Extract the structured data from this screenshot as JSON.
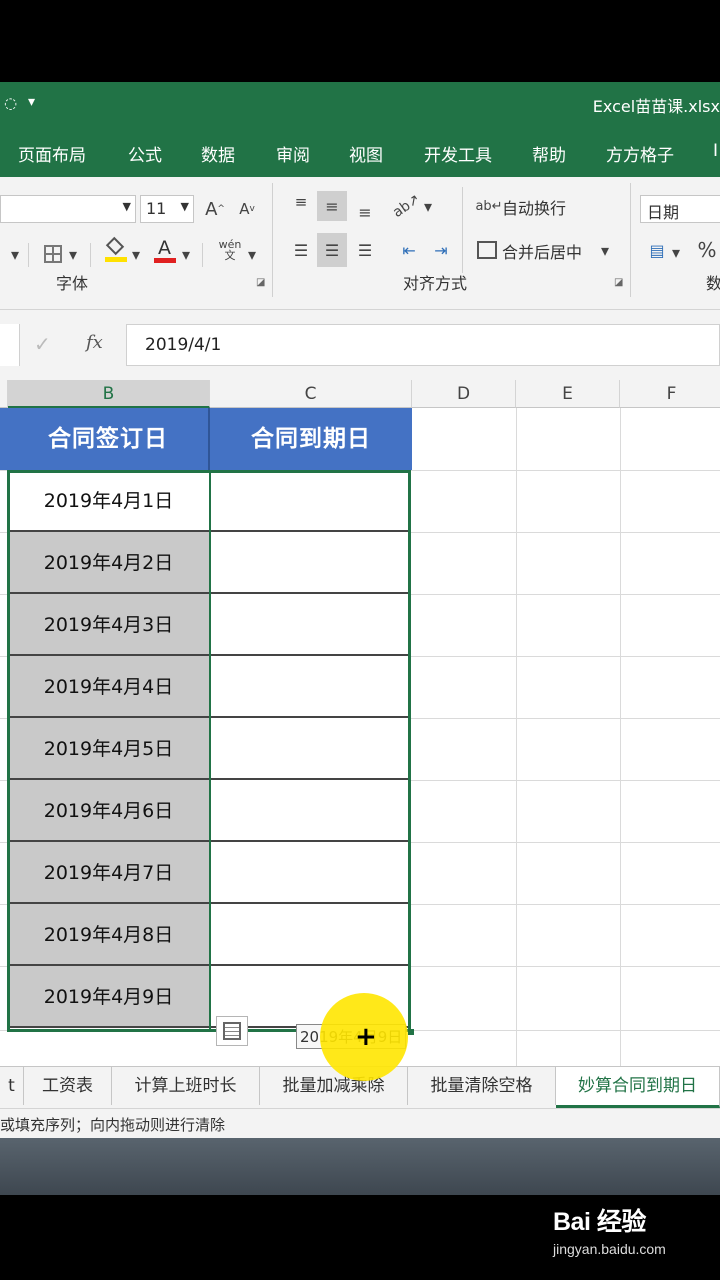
{
  "window": {
    "title": "Excel苗苗课.xlsx",
    "quick_access_icon": "dropdown-arrow-icon"
  },
  "ribbon_tabs": [
    "页面布局",
    "公式",
    "数据",
    "审阅",
    "视图",
    "开发工具",
    "帮助",
    "方方格子",
    "I"
  ],
  "ribbon": {
    "font_size": "11",
    "font_size_up": "A",
    "font_size_down": "A",
    "font_color_label": "A",
    "phonetic_label": "wén 文",
    "wrap_text": "自动换行",
    "merge_center": "合并后居中",
    "number_format": "日期",
    "percent": "%",
    "font_group": "字体",
    "align_group": "对齐方式",
    "number_group_partial": "数",
    "accent_color": "#217346"
  },
  "formula_bar": {
    "check_icon": "✓",
    "fx_label": "fx",
    "value": "2019/4/1"
  },
  "columns": [
    "B",
    "C",
    "D",
    "E",
    "F"
  ],
  "table": {
    "headers": [
      "合同签订日",
      "合同到期日"
    ],
    "rows": [
      "2019年4月1日",
      "2019年4月2日",
      "2019年4月3日",
      "2019年4月4日",
      "2019年4月5日",
      "2019年4月6日",
      "2019年4月7日",
      "2019年4月8日",
      "2019年4月9日"
    ],
    "header_color": "#4472c4"
  },
  "fill_tooltip": "2019年4月9日",
  "sheet_tabs": [
    "工资表",
    "计算上班时长",
    "批量加减乘除",
    "批量清除空格",
    "妙算合同到期日"
  ],
  "sheet_tab_partial": "t",
  "status_text": "或填充序列；向内拖动则进行清除",
  "watermark": {
    "logo": "Bai 经验",
    "url": "jingyan.baidu.com"
  }
}
